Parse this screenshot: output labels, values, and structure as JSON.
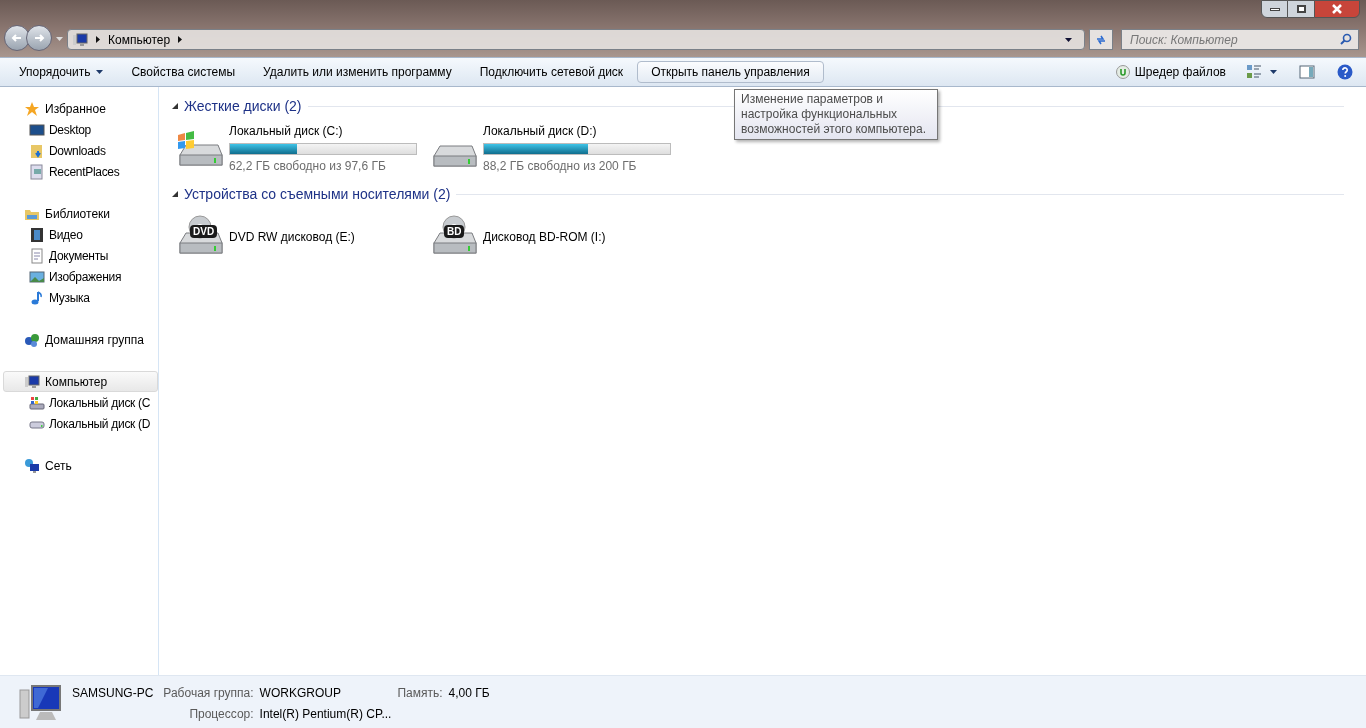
{
  "address_bar": {
    "path": [
      "Компьютер"
    ]
  },
  "search": {
    "placeholder": "Поиск: Компьютер"
  },
  "toolbar": {
    "buttons": [
      {
        "label": "Упорядочить",
        "kind": "menu",
        "hovered": false
      },
      {
        "label": "Свойства системы",
        "kind": "plain",
        "hovered": false
      },
      {
        "label": "Удалить или изменить программу",
        "kind": "plain",
        "hovered": false
      },
      {
        "label": "Подключить сетевой диск",
        "kind": "plain",
        "hovered": false
      },
      {
        "label": "Открыть панель управления",
        "kind": "plain",
        "hovered": true
      }
    ],
    "shredder": {
      "label": "Шредер файлов"
    }
  },
  "tooltip": {
    "text": "Изменение параметров и настройка функциональных возможностей этого компьютера."
  },
  "sidebar": {
    "groups": [
      {
        "label": "Избранное",
        "kind": "star",
        "selected": false,
        "children": [
          {
            "label": "Desktop",
            "kind": "desktop",
            "selected": false
          },
          {
            "label": "Downloads",
            "kind": "downloads",
            "selected": false
          },
          {
            "label": "RecentPlaces",
            "kind": "recent",
            "selected": false
          }
        ]
      },
      {
        "label": "Библиотеки",
        "kind": "library",
        "selected": false,
        "children": [
          {
            "label": "Видео",
            "kind": "video",
            "selected": false
          },
          {
            "label": "Документы",
            "kind": "document",
            "selected": false
          },
          {
            "label": "Изображения",
            "kind": "image",
            "selected": false
          },
          {
            "label": "Музыка",
            "kind": "music",
            "selected": false
          }
        ]
      },
      {
        "label": "Домашняя группа",
        "kind": "homegroup",
        "selected": false
      },
      {
        "label": "Компьютер",
        "kind": "computer",
        "selected": true,
        "children": [
          {
            "label": "Локальный диск (C",
            "kind": "disk-windows",
            "selected": false
          },
          {
            "label": "Локальный диск (D",
            "kind": "disk",
            "selected": false
          }
        ]
      },
      {
        "label": "Сеть",
        "kind": "network",
        "selected": false
      }
    ]
  },
  "sections": [
    {
      "title": "Жесткие диски (2)",
      "items": [
        {
          "name": "Локальный диск (C:)",
          "kind": "disk-windows",
          "level": 0.36,
          "free": "62,2 ГБ свободно из 97,6 ГБ"
        },
        {
          "name": "Локальный диск (D:)",
          "kind": "disk",
          "level": 0.56,
          "free": "88,2 ГБ свободно из 200 ГБ"
        }
      ]
    },
    {
      "title": "Устройства со съемными носителями (2)",
      "items": [
        {
          "name": "DVD RW дисковод (E:)",
          "kind": "dvd",
          "badge": "DVD"
        },
        {
          "name": "Дисковод BD-ROM (I:)",
          "kind": "dvd",
          "badge": "BD"
        }
      ]
    }
  ],
  "details": {
    "name": "SAMSUNG-PC",
    "fields": [
      {
        "label": "Рабочая группа:",
        "value": "WORKGROUP"
      },
      {
        "label": "Память:",
        "value": "4,00 ГБ"
      },
      {
        "label": "Процессор:",
        "value": "Intel(R) Pentium(R) CP..."
      }
    ]
  }
}
